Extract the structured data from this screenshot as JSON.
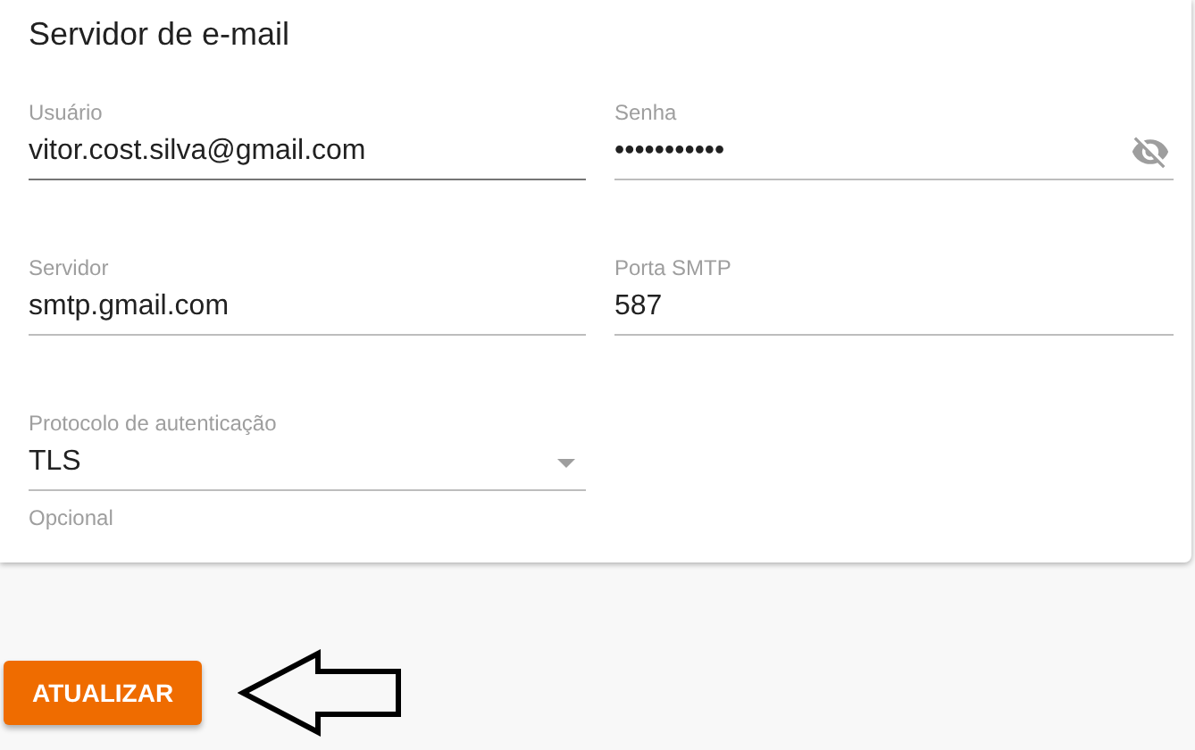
{
  "card": {
    "title": "Servidor de e-mail",
    "fields": [
      {
        "kind": "text",
        "label": "Usuário",
        "value": "vitor.cost.silva@gmail.com",
        "highlighted": true
      },
      {
        "kind": "password",
        "label": "Senha",
        "value": "•••••••••••",
        "highlighted": false,
        "password_visible": false
      },
      {
        "kind": "text",
        "label": "Servidor",
        "value": "smtp.gmail.com",
        "highlighted": false
      },
      {
        "kind": "text",
        "label": "Porta SMTP",
        "value": "587",
        "highlighted": false
      },
      {
        "kind": "select",
        "label": "Protocolo de autenticação",
        "value": "TLS",
        "highlighted": false,
        "helper": "Opcional"
      }
    ]
  },
  "button": {
    "label": "ATUALIZAR"
  }
}
